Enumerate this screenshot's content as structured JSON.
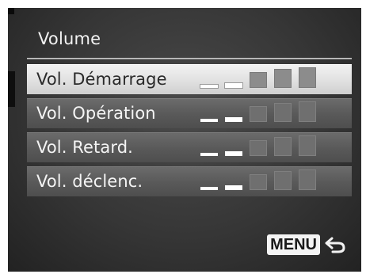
{
  "screen": {
    "title": "Volume"
  },
  "menu": {
    "items": [
      {
        "label": "Vol. Démarrage",
        "level": 2,
        "max": 5,
        "selected": true
      },
      {
        "label": "Vol. Opération",
        "level": 2,
        "max": 5,
        "selected": false
      },
      {
        "label": "Vol. Retard.",
        "level": 2,
        "max": 5,
        "selected": false
      },
      {
        "label": "Vol. déclenc.",
        "level": 2,
        "max": 5,
        "selected": false
      }
    ]
  },
  "footer": {
    "menu_label": "MENU",
    "back_icon": "return-arrow-icon"
  },
  "colors": {
    "background": "#363636",
    "selected_row": "#e2e2e2",
    "row": "#5a5a5a",
    "text": "#f4f4f4"
  }
}
